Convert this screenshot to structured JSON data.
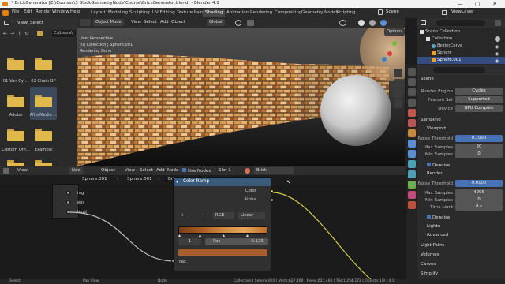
{
  "window": {
    "title": "* BrickGenerator [E:\\Courses\\3 BlockGeometryNode\\Course\\BrickGenerator.blend] - Blender 4.1",
    "min": "—",
    "max": "□",
    "close": "✕"
  },
  "menu": {
    "items": [
      "File",
      "Edit",
      "Render",
      "Window",
      "Help"
    ],
    "workspaces": [
      "Layout",
      "Modeling",
      "Sculpting",
      "UV Editing",
      "Texture Paint",
      "Shading",
      "Animation",
      "Rendering",
      "Compositing",
      "Geometry Nodes",
      "Scripting"
    ],
    "active_workspace": "Shading",
    "scene": "Scene",
    "view_layer": "ViewLayer"
  },
  "filebrowser": {
    "view": "View",
    "select": "Select",
    "path": "C:\\Users\\",
    "folders": [
      {
        "label": "01 Van Cyl..."
      },
      {
        "label": "02 Chain BP"
      },
      {
        "label": "Adobe"
      },
      {
        "label": "AfterMedia ..."
      },
      {
        "label": "Custom Offi..."
      },
      {
        "label": "Example"
      }
    ]
  },
  "viewport": {
    "mode": "Object Mode",
    "view": "View",
    "select": "Select",
    "add": "Add",
    "object": "Object",
    "global": "Global",
    "options": "Options",
    "overlay_lines": [
      "User Perspective",
      "(0) Collection | Sphere.001",
      "Rendering Done"
    ]
  },
  "outliner": {
    "root": "Scene Collection",
    "items": [
      {
        "label": "Collection"
      },
      {
        "label": "BezierCurve"
      },
      {
        "label": "Sphere"
      },
      {
        "label": "Sphere.001"
      }
    ],
    "search_placeholder": ""
  },
  "properties": {
    "scene_label": "Scene",
    "rows": [
      {
        "label": "Render Engine",
        "value": "Cycles"
      },
      {
        "label": "Feature Set",
        "value": "Supported"
      },
      {
        "label": "Device",
        "value": "GPU Compute"
      }
    ],
    "sampling": "Sampling",
    "viewport": "Viewport",
    "vp_rows": [
      {
        "label": "Noise Threshold",
        "value": "0.1000"
      },
      {
        "label": "Max Samples",
        "value": "20"
      },
      {
        "label": "Min Samples",
        "value": "0"
      }
    ],
    "denoise": "Denoise",
    "render": "Render",
    "r_rows": [
      {
        "label": "Noise Threshold",
        "value": "0.0100"
      },
      {
        "label": "Max Samples",
        "value": "4096"
      },
      {
        "label": "Min Samples",
        "value": "0"
      },
      {
        "label": "Time Limit",
        "value": "0 s"
      }
    ],
    "denoise2": "Denoise",
    "lights": "Lights",
    "advanced": "Advanced",
    "light_paths": "Light Paths",
    "volumes": "Volumes",
    "curves": "Curves",
    "simplify": "Simplify"
  },
  "nodeeditor": {
    "object": "Object",
    "view": "View",
    "select": "Select",
    "add": "Add",
    "node": "Node",
    "use_nodes": "Use Nodes",
    "slot": "Slot 1",
    "material": "Brick",
    "breadcrumb": [
      "Sphere.001",
      "Sphere.001",
      "Brick"
    ],
    "left_node_outputs": [
      "ing",
      "ess",
      "lend"
    ],
    "color_ramp": {
      "title": "Color Ramp",
      "out_color": "Color",
      "out_alpha": "Alpha",
      "plus": "+",
      "minus": "−",
      "mode": "RGB",
      "interp": "Linear",
      "index": "1",
      "pos_label": "Pos",
      "pos_value": "0.125",
      "fac": "Fac"
    }
  },
  "status": {
    "select": "Select",
    "pan": "Pan View",
    "node": "Node",
    "stats": "Collection | Sphere.001 | Verts:627,460 | Faces:627,460 | Tris:1,254,272 | Objects:1/3 | 4.1"
  }
}
